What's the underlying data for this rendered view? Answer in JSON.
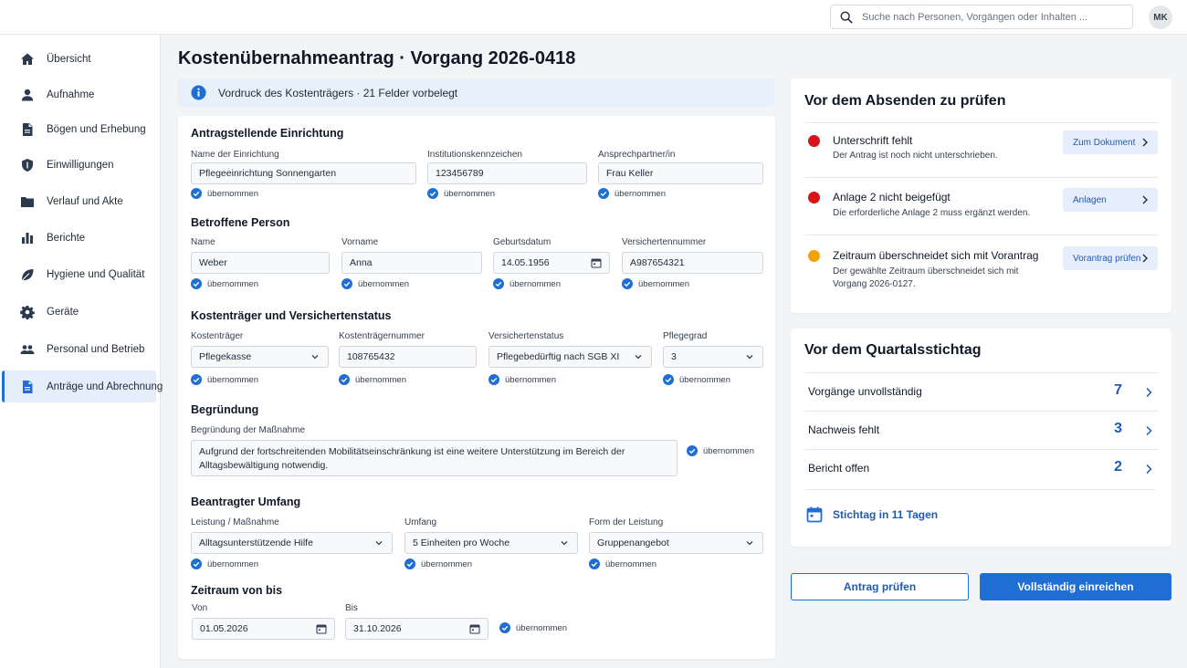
{
  "search": {
    "placeholder": "Suche nach Personen, Vorgängen oder Inhalten ..."
  },
  "user": {
    "initials": "MK"
  },
  "sidebar": {
    "items": [
      {
        "label": "Übersicht",
        "icon": "home-icon"
      },
      {
        "label": "Aufnahme",
        "icon": "person-icon"
      },
      {
        "label": "Bögen und Erhebung",
        "icon": "document-icon"
      },
      {
        "label": "Einwilligungen",
        "icon": "shield-icon"
      },
      {
        "label": "Verlauf und Akte",
        "icon": "folder-icon"
      },
      {
        "label": "Berichte",
        "icon": "bar-chart-icon"
      },
      {
        "label": "Hygiene und Qualität",
        "icon": "leaf-icon"
      },
      {
        "label": "Geräte",
        "icon": "gear-icon"
      },
      {
        "label": "Personal und Betrieb",
        "icon": "people-icon"
      },
      {
        "label": "Anträge und Abrechnung",
        "icon": "document-icon",
        "active": true
      }
    ]
  },
  "page": {
    "title": "Kostenübernahmeantrag · Vorgang 2026-0418",
    "banner": "Vordruck des Kostenträgers · 21 Felder vorbelegt"
  },
  "form": {
    "confirmed_label": "übernommen",
    "s1": {
      "title": "Antragstellende Einrichtung",
      "name_label": "Name der Einrichtung",
      "name_value": "Pflegeeinrichtung Sonnengarten",
      "ik_label": "Institutionskennzeichen",
      "ik_value": "123456789",
      "contact_label": "Ansprechpartner/in",
      "contact_value": "Frau Keller"
    },
    "s2": {
      "title": "Betroffene Person",
      "lastname_label": "Name",
      "lastname_value": "Weber",
      "firstname_label": "Vorname",
      "firstname_value": "Anna",
      "dob_label": "Geburtsdatum",
      "dob_value": "14.05.1956",
      "insno_label": "Versichertennummer",
      "insno_value": "A987654321"
    },
    "s3": {
      "title": "Kostenträger und Versichertenstatus",
      "payer_label": "Kostenträger",
      "payer_value": "Pflegekasse",
      "payerno_label": "Kostenträgernummer",
      "payerno_value": "108765432",
      "status_label": "Versichertenstatus",
      "status_value": "Pflegebedürftig nach SGB XI",
      "grade_label": "Pflegegrad",
      "grade_value": "3"
    },
    "s4": {
      "title": "Begründung",
      "reason_label": "Begründung der Maßnahme",
      "reason_value": "Aufgrund der fortschreitenden Mobilitätseinschränkung ist eine weitere Unterstützung im Bereich der Alltagsbewältigung notwendig."
    },
    "s5": {
      "title": "Beantragter Umfang",
      "service_label": "Leistung / Maßnahme",
      "service_value": "Alltagsunterstützende Hilfe",
      "scope_label": "Umfang",
      "scope_value": "5 Einheiten pro Woche",
      "form_label": "Form der Leistung",
      "form_value": "Gruppenangebot"
    },
    "s6": {
      "title": "Zeitraum von bis",
      "from_label": "Von",
      "from_value": "01.05.2026",
      "to_label": "Bis",
      "to_value": "31.10.2026"
    }
  },
  "checks": {
    "title": "Vor dem Absenden zu prüfen",
    "items": [
      {
        "status": "error",
        "color": "#d7141a",
        "title": "Unterschrift fehlt",
        "desc": "Der Antrag ist noch nicht unterschrieben.",
        "action": "Zum Dokument"
      },
      {
        "status": "error",
        "color": "#d7141a",
        "title": "Anlage 2 nicht beigefügt",
        "desc": "Die erforderliche Anlage 2 muss ergänzt werden.",
        "action": "Anlagen"
      },
      {
        "status": "warning",
        "color": "#f2a200",
        "title": "Zeitraum überschneidet sich mit Vorantrag",
        "desc": "Der gewählte Zeitraum überschneidet sich mit Vorgang 2026-0127.",
        "action": "Vorantrag prüfen"
      }
    ]
  },
  "quarter": {
    "title": "Vor dem Quartalsstichtag",
    "rows": [
      {
        "label": "Vorgänge unvollständig",
        "count": "7"
      },
      {
        "label": "Nachweis fehlt",
        "count": "3"
      },
      {
        "label": "Bericht offen",
        "count": "2"
      }
    ],
    "deadline": "Stichtag in 11 Tagen"
  },
  "actions": {
    "check": "Antrag prüfen",
    "submit": "Vollständig einreichen"
  },
  "colors": {
    "accent": "#1f6ed4",
    "error": "#d7141a",
    "warning": "#f2a200"
  }
}
